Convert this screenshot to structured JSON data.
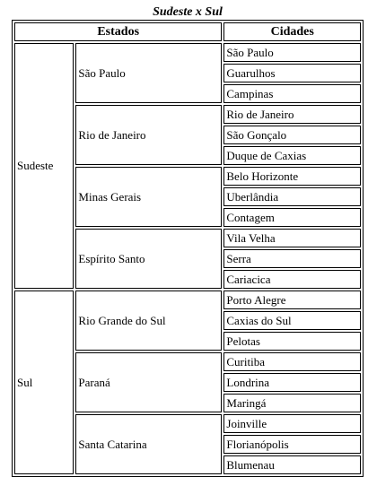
{
  "caption": "Sudeste x Sul",
  "headers": {
    "estados": "Estados",
    "cidades": "Cidades"
  },
  "regions": [
    {
      "name": "Sudeste",
      "states": [
        {
          "name": "São Paulo",
          "cities": [
            "São Paulo",
            "Guarulhos",
            "Campinas"
          ]
        },
        {
          "name": "Rio de Janeiro",
          "cities": [
            "Rio de Janeiro",
            "São Gonçalo",
            "Duque de Caxias"
          ]
        },
        {
          "name": "Minas Gerais",
          "cities": [
            "Belo Horizonte",
            "Uberlândia",
            "Contagem"
          ]
        },
        {
          "name": "Espírito Santo",
          "cities": [
            "Vila Velha",
            "Serra",
            "Cariacica"
          ]
        }
      ]
    },
    {
      "name": "Sul",
      "states": [
        {
          "name": "Rio Grande do Sul",
          "cities": [
            "Porto Alegre",
            "Caxias do Sul",
            "Pelotas"
          ]
        },
        {
          "name": "Paraná",
          "cities": [
            "Curitiba",
            "Londrina",
            "Maringá"
          ]
        },
        {
          "name": "Santa Catarina",
          "cities": [
            "Joinville",
            "Florianópolis",
            "Blumenau"
          ]
        }
      ]
    }
  ]
}
